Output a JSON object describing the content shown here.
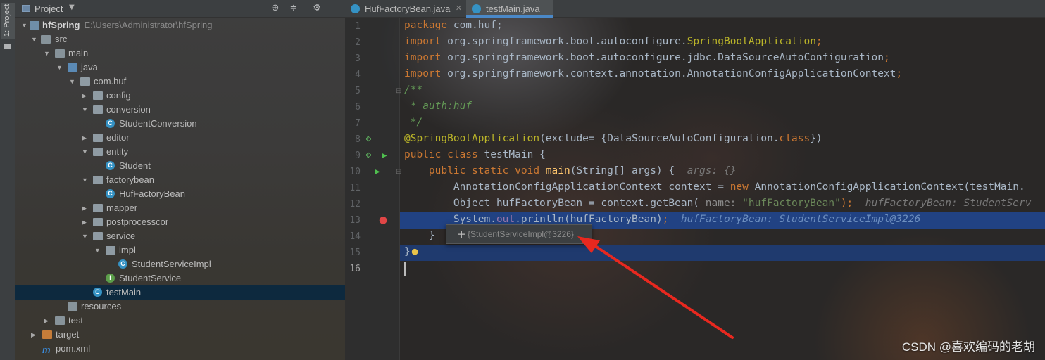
{
  "tool_strip": {
    "project_tab": "1: Project"
  },
  "project_panel": {
    "title": "Project",
    "tree": [
      {
        "label": "hfSpring",
        "path": "E:\\Users\\Administrator\\hfSpring"
      },
      {
        "label": "src"
      },
      {
        "label": "main"
      },
      {
        "label": "java"
      },
      {
        "label": "com.huf"
      },
      {
        "label": "config"
      },
      {
        "label": "conversion"
      },
      {
        "label": "StudentConversion"
      },
      {
        "label": "editor"
      },
      {
        "label": "entity"
      },
      {
        "label": "Student"
      },
      {
        "label": "factorybean"
      },
      {
        "label": "HufFactoryBean"
      },
      {
        "label": "mapper"
      },
      {
        "label": "postprocesscor"
      },
      {
        "label": "service"
      },
      {
        "label": "impl"
      },
      {
        "label": "StudentServiceImpl"
      },
      {
        "label": "StudentService"
      },
      {
        "label": "testMain"
      },
      {
        "label": "resources"
      },
      {
        "label": "test"
      },
      {
        "label": "target"
      },
      {
        "label": "pom.xml"
      }
    ]
  },
  "editor": {
    "tabs": [
      {
        "label": "HufFactoryBean.java",
        "active": false
      },
      {
        "label": "testMain.java",
        "active": true
      }
    ],
    "line_numbers": [
      "1",
      "2",
      "3",
      "4",
      "5",
      "6",
      "7",
      "8",
      "9",
      "10",
      "11",
      "12",
      "13",
      "14",
      "15",
      "16"
    ],
    "code": {
      "l1": [
        "package",
        " com.huf;"
      ],
      "l2": [
        "import",
        " org.springframework.boot.autoconfigure.",
        "SpringBootApplication",
        ";"
      ],
      "l3": [
        "import",
        " org.springframework.boot.autoconfigure.jdbc.DataSourceAutoConfiguration",
        ";"
      ],
      "l4": [
        "import",
        " org.springframework.context.annotation.AnnotationConfigApplicationContext",
        ";"
      ],
      "l5": [
        "/**"
      ],
      "l6": [
        " * auth:huf"
      ],
      "l7": [
        " */"
      ],
      "l8": [
        "@SpringBootApplication",
        "(exclude= {DataSourceAutoConfiguration.",
        "class",
        "})"
      ],
      "l9": [
        "public class",
        " testMain {"
      ],
      "l10": [
        "    public static void",
        " ",
        "main",
        "(String[] args) {",
        "  args: {}"
      ],
      "l11": [
        "        AnnotationConfigApplicationContext context = ",
        "new",
        " AnnotationConfigApplicationContext(testMain."
      ],
      "l12": [
        "        Object hufFactoryBean = context.getBean(",
        " name:",
        " \"hufFactoryBean\"",
        ");",
        "  hufFactoryBean: StudentServ"
      ],
      "l13": [
        "        System.",
        "out",
        ".println(hufFactoryBean)",
        ";",
        "  hufFactoryBean: StudentServiceImpl@3226"
      ],
      "l14": [
        "    }"
      ],
      "l15": [
        "}"
      ]
    },
    "popup": {
      "expand": "+",
      "text": "{StudentServiceImpl@3226}"
    }
  },
  "watermark": "CSDN @喜欢编码的老胡",
  "colors": {
    "keyword": "#cc7832",
    "annotation": "#bbb529",
    "comment": "#629755",
    "string": "#6a8759",
    "selection": "#214283"
  }
}
